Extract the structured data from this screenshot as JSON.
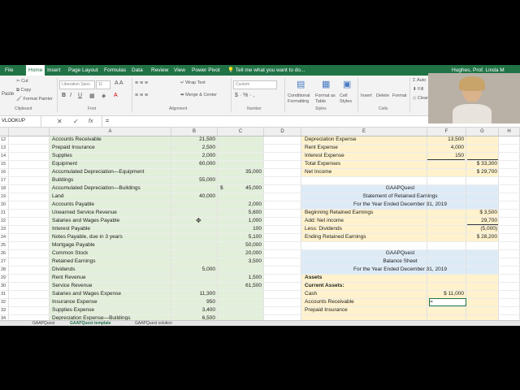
{
  "ribbon": {
    "menus": [
      {
        "label": "File",
        "active": false
      },
      {
        "label": "Home",
        "active": true
      },
      {
        "label": "Insert",
        "active": false
      },
      {
        "label": "Page Layout",
        "active": false
      },
      {
        "label": "Formulas",
        "active": false
      },
      {
        "label": "Data",
        "active": false
      },
      {
        "label": "Review",
        "active": false
      },
      {
        "label": "View",
        "active": false
      },
      {
        "label": "Power Pivot",
        "active": false
      }
    ],
    "tell_me": "Tell me what you want to do...",
    "user": "Hughes, Prof. Linda M",
    "clipboard": {
      "cut": "Cut",
      "copy": "Copy",
      "format_painter": "Format Painter",
      "paste": "Paste",
      "group": "Clipboard"
    },
    "font": {
      "name": "Liberation Sans",
      "size": "11",
      "group": "Font"
    },
    "alignment": {
      "wrap": "Wrap Text",
      "merge": "Merge & Center",
      "group": "Alignment"
    },
    "number": {
      "format": "Custom",
      "group": "Number"
    },
    "styles": {
      "conditional": "Conditional Formatting",
      "format_table": "Format as Table",
      "cell_styles": "Cell Styles",
      "group": "Styles"
    },
    "cells": {
      "insert": "Insert",
      "delete": "Delete",
      "format": "Format",
      "group": "Cells"
    },
    "editing": {
      "autosum": "Auto",
      "fill": "Fill",
      "clear": "Clear"
    }
  },
  "formula_bar": {
    "name_box": "VLOOKUP",
    "content": "="
  },
  "columns": [
    "A",
    "B",
    "C",
    "D",
    "E",
    "F",
    "G",
    "H"
  ],
  "rows": [
    12,
    13,
    14,
    15,
    16,
    17,
    18,
    19,
    20,
    21,
    22,
    23,
    24,
    25,
    26,
    27,
    28,
    29,
    30,
    31,
    32,
    33,
    34
  ],
  "trial_balance": [
    {
      "account": "Accounts Receivable",
      "debit": "21,500",
      "credit": ""
    },
    {
      "account": "Prepaid Insurance",
      "debit": "2,500",
      "credit": ""
    },
    {
      "account": "Supplies",
      "debit": "2,000",
      "credit": ""
    },
    {
      "account": "Equipment",
      "debit": "60,000",
      "credit": ""
    },
    {
      "account": "Accumulated Depreciation—Equipment",
      "debit": "",
      "credit": "35,000"
    },
    {
      "account": "Buildings",
      "debit": "55,000",
      "credit": ""
    },
    {
      "account": "Accumulated Depreciation—Buildings",
      "debit": "",
      "credit": "45,000",
      "dollar": "$"
    },
    {
      "account": "Land",
      "debit": "40,000",
      "credit": ""
    },
    {
      "account": "Accounts Payable",
      "debit": "",
      "credit": "2,000"
    },
    {
      "account": "Unearned Service Revenue",
      "debit": "",
      "credit": "5,600"
    },
    {
      "account": "Salaries and Wages Payable",
      "debit": "",
      "credit": "1,000"
    },
    {
      "account": "Interest Payable",
      "debit": "",
      "credit": "100"
    },
    {
      "account": "Notes Payable, due in 3 years",
      "debit": "",
      "credit": "5,100"
    },
    {
      "account": "Mortgage Payable",
      "debit": "",
      "credit": "50,000"
    },
    {
      "account": "Common Stock",
      "debit": "",
      "credit": "20,000"
    },
    {
      "account": "Retained Earnings",
      "debit": "",
      "credit": "3,500"
    },
    {
      "account": "Dividends",
      "debit": "5,000",
      "credit": ""
    },
    {
      "account": "Rent Revenue",
      "debit": "",
      "credit": "1,500"
    },
    {
      "account": "Service Revenue",
      "debit": "",
      "credit": "61,500"
    },
    {
      "account": "Salaries and Wages Expense",
      "debit": "11,300",
      "credit": ""
    },
    {
      "account": "Insurance Expense",
      "debit": "950",
      "credit": ""
    },
    {
      "account": "Supplies Expense",
      "debit": "3,400",
      "credit": ""
    },
    {
      "account": "Depreciation Expense—Buildings",
      "debit": "6,500",
      "credit": ""
    }
  ],
  "statements": [
    {
      "f": "Depreciation Expense",
      "g": "13,500",
      "h": ""
    },
    {
      "f": "Rent Expense",
      "g": "4,000",
      "h": ""
    },
    {
      "f": "Interest Expense",
      "g": "150",
      "h": ""
    },
    {
      "f": "Total Expenses",
      "g": "",
      "h": "$    33,300"
    },
    {
      "f": "Net Income",
      "g": "",
      "h": "$    29,700"
    },
    {
      "f": "",
      "g": "",
      "h": ""
    },
    {
      "f": "",
      "center": "GAAPQuest"
    },
    {
      "f": "",
      "center": "Statement of Retained Earnings"
    },
    {
      "f": "",
      "center": "For the Year Ended December 31, 2019"
    },
    {
      "f": "Beginning Retained Earnings",
      "g": "",
      "h": "$     3,500"
    },
    {
      "f": "Add: Net income",
      "g": "",
      "h": "29,700"
    },
    {
      "f": "Less: Dividends",
      "g": "",
      "h": "(5,000)"
    },
    {
      "f": "Ending Retained Earnings",
      "g": "",
      "h": "$   28,200"
    },
    {
      "f": "",
      "g": "",
      "h": ""
    },
    {
      "f": "",
      "center": "GAAPQuest"
    },
    {
      "f": "",
      "center": "Balance Sheet"
    },
    {
      "f": "",
      "center": "For the Year Ended December 31, 2019"
    },
    {
      "f": "Assets",
      "g": "",
      "h": "",
      "bold": true
    },
    {
      "f": "Current Assets:",
      "g": "",
      "h": "",
      "bold": true
    },
    {
      "f": "Cash",
      "g": "$      11,000",
      "h": ""
    },
    {
      "f": "Accounts Receivable",
      "g": "=",
      "h": ""
    },
    {
      "f": "Prepaid Insurance",
      "g": "",
      "h": ""
    },
    {
      "f": "",
      "g": "",
      "h": ""
    }
  ],
  "sheet_tabs": [
    "GAAPQuest",
    "GAAPQuest template",
    "GAAPQuest solution"
  ],
  "colors": {
    "excel_green": "#217346",
    "trial_balance_fill": "#e2efda",
    "statement_fill": "#fff2cc",
    "heading_fill": "#ddebf7"
  }
}
